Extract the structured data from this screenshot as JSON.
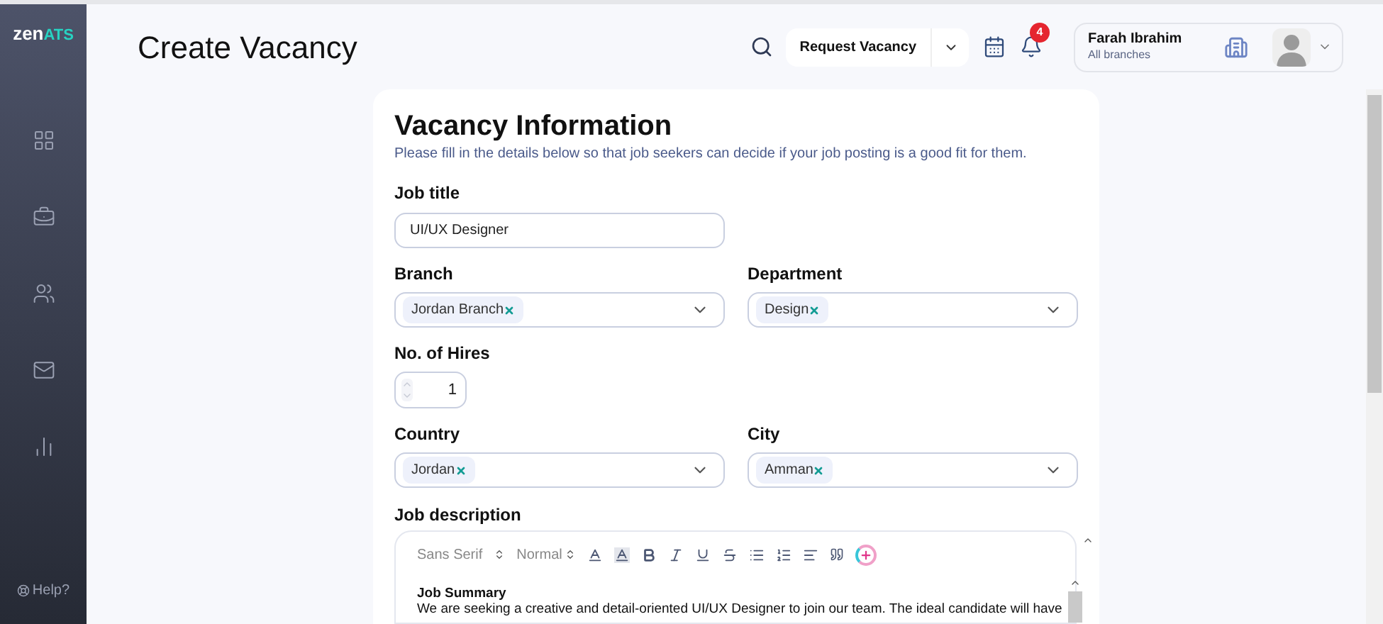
{
  "sidebar": {
    "logo": {
      "main": "zen",
      "accent": "ATS"
    },
    "items": [
      {
        "kind": "grid",
        "selected": false
      },
      {
        "kind": "briefcase",
        "selected": false
      },
      {
        "kind": "users",
        "selected": false
      },
      {
        "kind": "mail",
        "selected": false
      },
      {
        "kind": "chart",
        "selected": false
      }
    ],
    "help": "Help?"
  },
  "header": {
    "title": "Create Vacancy",
    "request_button": "Request Vacancy",
    "notification_count": "4",
    "user": {
      "name": "Farah Ibrahim",
      "scope": "All branches"
    }
  },
  "form": {
    "title": "Vacancy Information",
    "subtitle": "Please fill in the details below so that job seekers can decide if your job posting is a good fit for them.",
    "rows": [
      [
        {
          "kind": "text",
          "label": "Job title",
          "value": "UI/UX Designer"
        }
      ],
      [
        {
          "kind": "multiselect",
          "label": "Branch",
          "tags": [
            "Jordan Branch"
          ]
        },
        {
          "kind": "multiselect",
          "label": "Department",
          "tags": [
            "Design"
          ]
        }
      ],
      [
        {
          "kind": "number",
          "label": "No. of Hires",
          "value": "1"
        }
      ],
      [
        {
          "kind": "multiselect",
          "label": "Country",
          "tags": [
            "Jordan"
          ]
        },
        {
          "kind": "multiselect",
          "label": "City",
          "tags": [
            "Amman"
          ]
        }
      ]
    ],
    "description": {
      "label": "Job description",
      "font": "Sans Serif",
      "size": "Normal",
      "heading": "Job Summary",
      "text": "We are seeking a creative and detail-oriented UI/UX Designer to join our team. The ideal candidate will have"
    }
  }
}
